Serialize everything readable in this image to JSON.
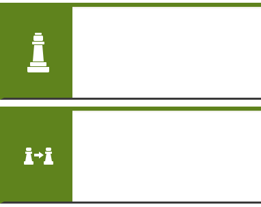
{
  "colors": {
    "accent_green": "#5f831d",
    "icon_white": "#ffffff",
    "bottom_border": "#3a3a3a"
  },
  "cards": [
    {
      "icon": "chess-pawn-icon"
    },
    {
      "icon": "pawn-swap-icon"
    }
  ]
}
